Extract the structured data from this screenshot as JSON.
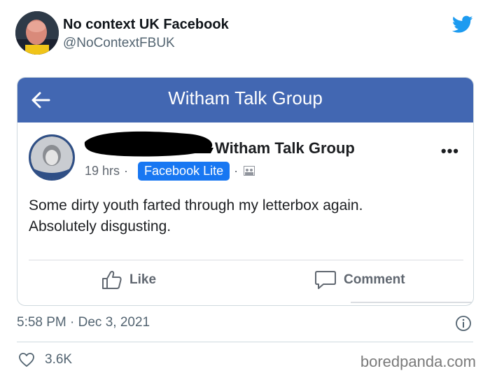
{
  "tweet": {
    "display_name": "No context UK Facebook",
    "handle": "@NoContextFBUK",
    "timestamp": "5:58 PM · Dec 3, 2021",
    "likes_count": "3.6K",
    "brand_icon": "twitter-bird-icon",
    "brand_color": "#1d9bf0"
  },
  "facebook_post": {
    "header_title": "Witham Talk Group",
    "header_color": "#4267b2",
    "group_name": "Witham Talk Group",
    "time_ago": "19 hrs",
    "separator": "·",
    "app_badge": "Facebook Lite",
    "badge_color": "#1877f2",
    "text_line_1": "Some dirty youth farted through my letterbox again.",
    "text_line_2": "Absolutely disgusting.",
    "like_label": "Like",
    "comment_label": "Comment"
  },
  "watermark": "boredpanda.com"
}
